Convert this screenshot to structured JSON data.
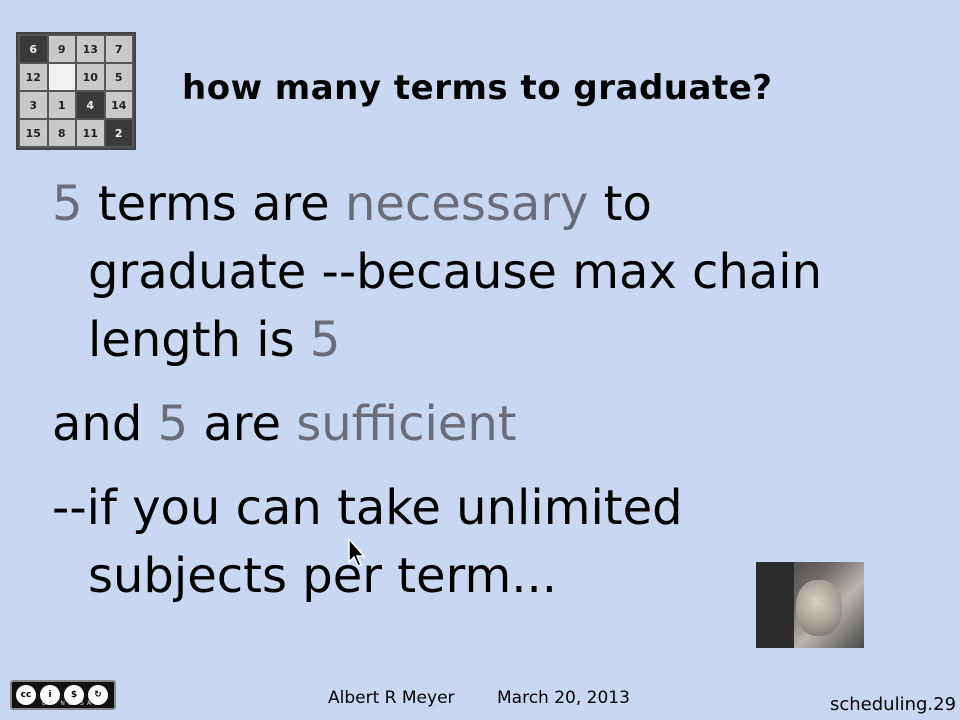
{
  "logo": {
    "tiles": [
      {
        "label": "6",
        "style": "dark"
      },
      {
        "label": "9",
        "style": "light"
      },
      {
        "label": "13",
        "style": "light"
      },
      {
        "label": "7",
        "style": "light"
      },
      {
        "label": "12",
        "style": "light"
      },
      {
        "label": "",
        "style": "blank"
      },
      {
        "label": "10",
        "style": "light"
      },
      {
        "label": "5",
        "style": "light"
      },
      {
        "label": "3",
        "style": "light"
      },
      {
        "label": "1",
        "style": "light"
      },
      {
        "label": "4",
        "style": "dark"
      },
      {
        "label": "14",
        "style": "light"
      },
      {
        "label": "15",
        "style": "light"
      },
      {
        "label": "8",
        "style": "light"
      },
      {
        "label": "11",
        "style": "light"
      },
      {
        "label": "2",
        "style": "dark"
      }
    ]
  },
  "title": "how many terms to graduate?",
  "body": {
    "p1": {
      "num": "5",
      "a": " terms are ",
      "hl": "necessary",
      "b": " to graduate --because max chain length is ",
      "num2": "5"
    },
    "p2": {
      "a": "and ",
      "num": "5",
      "b": " are ",
      "hl": "sufficient"
    },
    "p3": {
      "text": "--if you can take unlimited subjects per term..."
    }
  },
  "footer": {
    "license": "BY NC SA",
    "author": "Albert R Meyer",
    "date": "March 20, 2013",
    "slide_id": "scheduling.29"
  },
  "colors": {
    "background": "#c8d8f2",
    "highlight": "#6b6b7a"
  }
}
